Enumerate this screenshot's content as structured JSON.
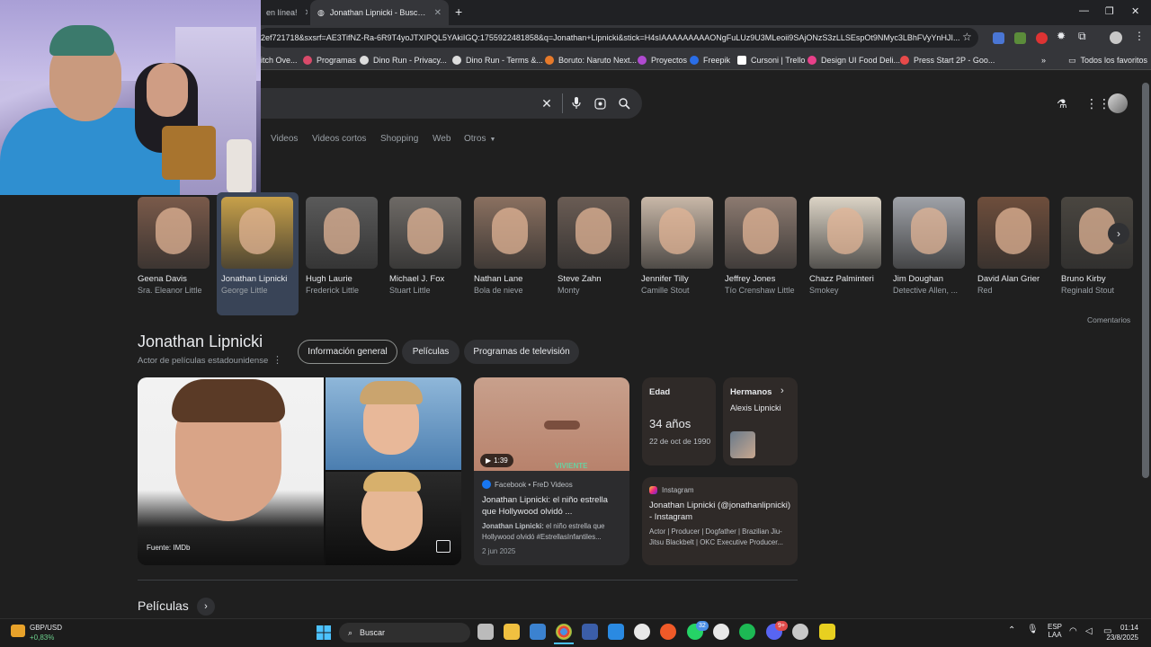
{
  "browser": {
    "tabs": [
      {
        "title": "en línea!"
      },
      {
        "title": "Jonathan Lipnicki - Buscar con G"
      }
    ],
    "new_tab": "+",
    "url": "2ef721718&sxsrf=AE3TifNZ-Ra-6R9T4yoJTXIPQL5YAkiIGQ:1755922481858&q=Jonathan+Lipnicki&stick=H4sIAAAAAAAAAONgFuLUz9U3MLeoii9SAjONzS3zLLSEspOt9NMyc3LBhFVyYnHJI...",
    "bookmarks": [
      {
        "label": "itch Ove..."
      },
      {
        "label": "Programas"
      },
      {
        "label": "Dino Run - Privacy..."
      },
      {
        "label": "Dino Run - Terms &..."
      },
      {
        "label": "Boruto: Naruto Next..."
      },
      {
        "label": "Proyectos"
      },
      {
        "label": "Freepik"
      },
      {
        "label": "Cursoni | Trello"
      },
      {
        "label": "Design UI Food Deli..."
      },
      {
        "label": "Press Start 2P - Goo..."
      }
    ],
    "all_bookmarks": "Todos los favoritos"
  },
  "search": {
    "nav": [
      "Videos",
      "Videos cortos",
      "Shopping",
      "Web",
      "Otros"
    ]
  },
  "carousel": [
    {
      "name": "Geena Davis",
      "role": "Sra. Eleanor Little",
      "color": "#7a5a4a"
    },
    {
      "name": "Jonathan Lipnicki",
      "role": "George Little",
      "color": "#c8a14a"
    },
    {
      "name": "Hugh Laurie",
      "role": "Frederick Little",
      "color": "#5a5a5a"
    },
    {
      "name": "Michael J. Fox",
      "role": "Stuart Little",
      "color": "#6e6a66"
    },
    {
      "name": "Nathan Lane",
      "role": "Bola de nieve",
      "color": "#8a7060"
    },
    {
      "name": "Steve Zahn",
      "role": "Monty",
      "color": "#6a5c54"
    },
    {
      "name": "Jennifer Tilly",
      "role": "Camille Stout",
      "color": "#c9b8a8"
    },
    {
      "name": "Jeffrey Jones",
      "role": "Tío Crenshaw Little",
      "color": "#8c7a70"
    },
    {
      "name": "Chazz Palminteri",
      "role": "Smokey",
      "color": "#dcd4c6"
    },
    {
      "name": "Jim Doughan",
      "role": "Detective Allen, ...",
      "color": "#9fa2a8"
    },
    {
      "name": "David Alan Grier",
      "role": "Red",
      "color": "#6e4e3c"
    },
    {
      "name": "Bruno Kirby",
      "role": "Reginald Stout",
      "color": "#4a4640"
    }
  ],
  "feedback": "Comentarios",
  "entity": {
    "title": "Jonathan Lipnicki",
    "subtitle": "Actor de películas estadounidense",
    "chips": [
      "Información general",
      "Películas",
      "Programas de televisión"
    ],
    "image_source": "Fuente: IMDb",
    "video": {
      "duration": "1:39",
      "source": "Facebook • FreD Videos",
      "title": "Jonathan Lipnicki: el niño estrella que Hollywood olvidó ...",
      "snippet_bold": "Jonathan Lipnicki:",
      "snippet": " el niño estrella que Hollywood olvidó #EstrellasInfantiles...",
      "date": "2 jun 2025"
    },
    "age": {
      "label": "Edad",
      "value": "34 años",
      "date": "22 de oct de 1990"
    },
    "siblings": {
      "label": "Hermanos",
      "name": "Alexis Lipnicki"
    },
    "instagram": {
      "source": "Instagram",
      "title": "Jonathan Lipnicki (@jonathanlipnicki) - Instagram",
      "snippet": "Actor | Producer | Dogfather | Brazilian Jiu-Jitsu Blackbelt | OKC Executive Producer..."
    },
    "section": "Películas"
  },
  "taskbar": {
    "ticker": "GBP/USD",
    "ticker_change": "+0,83%",
    "search": "Buscar",
    "lang1": "ESP",
    "lang2": "LAA",
    "time": "01:14",
    "date": "23/8/2025",
    "badge1": "32",
    "badge2": "9+"
  }
}
